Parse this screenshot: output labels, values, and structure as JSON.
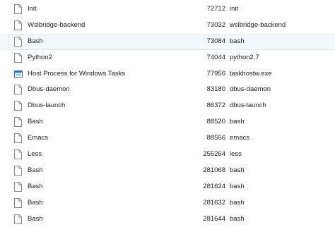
{
  "processes": [
    {
      "name": "Init",
      "pid": "72712",
      "image": "init",
      "icon": "blank-file-icon"
    },
    {
      "name": "Wslbridge-backend",
      "pid": "73032",
      "image": "wslbridge-backend",
      "icon": "blank-file-icon"
    },
    {
      "name": "Bash",
      "pid": "73084",
      "image": "bash",
      "icon": "blank-file-icon",
      "selected": true
    },
    {
      "name": "Python2",
      "pid": "74044",
      "image": "python2.7",
      "icon": "blank-file-icon"
    },
    {
      "name": "Host Process for Windows Tasks",
      "pid": "77956",
      "image": "taskhostw.exe",
      "icon": "window-app-icon"
    },
    {
      "name": "Dbus-daemon",
      "pid": "83180",
      "image": "dbus-daemon",
      "icon": "blank-file-icon"
    },
    {
      "name": "Dbus-launch",
      "pid": "86372",
      "image": "dbus-launch",
      "icon": "blank-file-icon"
    },
    {
      "name": "Bash",
      "pid": "88520",
      "image": "bash",
      "icon": "blank-file-icon"
    },
    {
      "name": "Emacs",
      "pid": "88556",
      "image": "emacs",
      "icon": "blank-file-icon"
    },
    {
      "name": "Less",
      "pid": "255264",
      "image": "less",
      "icon": "blank-file-icon"
    },
    {
      "name": "Bash",
      "pid": "281068",
      "image": "bash",
      "icon": "blank-file-icon"
    },
    {
      "name": "Bash",
      "pid": "281624",
      "image": "bash",
      "icon": "blank-file-icon"
    },
    {
      "name": "Bash",
      "pid": "281632",
      "image": "bash",
      "icon": "blank-file-icon"
    },
    {
      "name": "Bash",
      "pid": "281644",
      "image": "bash",
      "icon": "blank-file-icon"
    }
  ],
  "colors": {
    "text": "#1e1e1e",
    "selected_background": "#f3f8fd",
    "selected_border": "#dfe9f5",
    "icon_outline": "#8a8a8a",
    "app_icon_blue": "#2b6cb0"
  }
}
